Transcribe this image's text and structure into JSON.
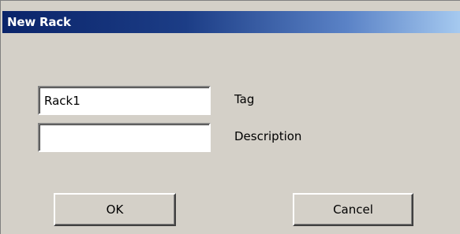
{
  "window": {
    "title": "New Rack"
  },
  "form": {
    "tag_value": "Rack1",
    "tag_label": "Tag",
    "description_value": "",
    "description_label": "Description"
  },
  "buttons": {
    "ok_label": "OK",
    "cancel_label": "Cancel"
  },
  "colors": {
    "dialog_background": "#d4d0c8",
    "titlebar_start": "#0a246a",
    "titlebar_end": "#a6caf0",
    "title_text": "#ffffff"
  }
}
